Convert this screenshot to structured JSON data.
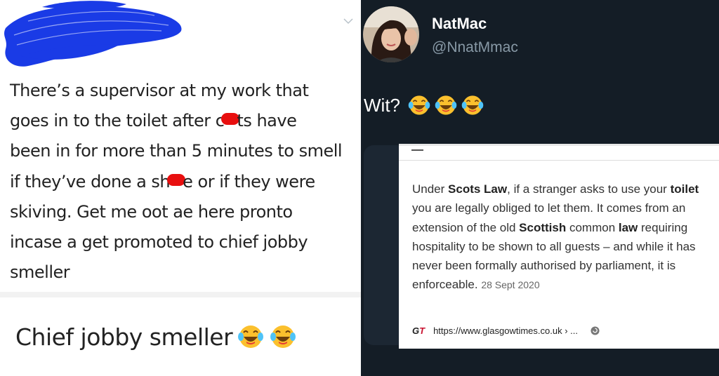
{
  "left_tweet": {
    "body_lines": [
      [
        "There’s a supervisor at my work that"
      ],
      [
        "goes in to the toilet after c",
        "ts have"
      ],
      [
        "been in for more than 5 minutes to smell"
      ],
      [
        "if they’ve done a sh",
        "e or if they were"
      ],
      [
        "skiving. Get me oot ae here pronto"
      ],
      [
        "incase a get promoted to chief jobby"
      ],
      [
        "smeller"
      ]
    ],
    "reply_text": "Chief jobby smeller",
    "redact_color": "#e80f0f",
    "scribble_color": "#1a3be6"
  },
  "right_tweet": {
    "display_name": "NatMac",
    "handle": "@NnatMmac",
    "text": "Wit?",
    "snippet": {
      "p1": "Under ",
      "b1": "Scots Law",
      "p2": ", if a stranger asks to use your ",
      "b2": "toilet",
      "p3": " you are legally obliged to let them. It comes from an extension of the old ",
      "b3": "Scottish",
      "p4": " common ",
      "b4": "law",
      "p5": " requiring hospitality to be shown to all guests – and while it has never been formally authorised by parliament, it is enforceable.",
      "date": "28 Sept 2020"
    },
    "source": {
      "logo_g": "G",
      "logo_t": "T",
      "url": "https://www.glasgowtimes.co.uk › ..."
    },
    "bg_color": "#141d26",
    "card_color": "#1c2733"
  },
  "icons": [
    "chevron-down-icon",
    "laughing-crying-emoji-icon",
    "info-icon",
    "avatar-photo"
  ]
}
